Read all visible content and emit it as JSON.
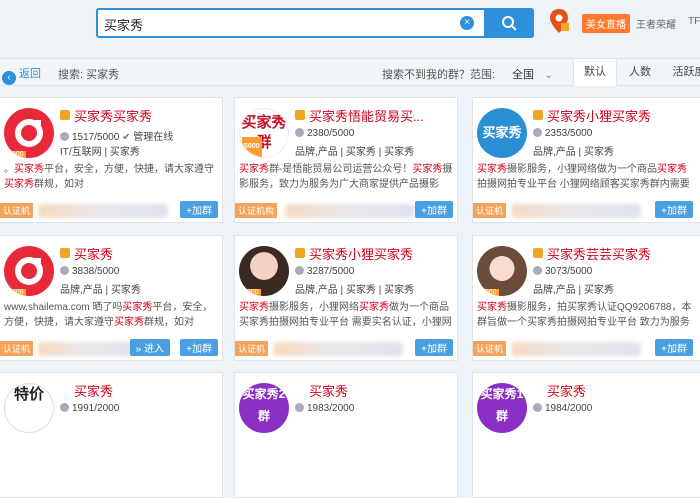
{
  "search": {
    "value": "买家秀"
  },
  "topbar": {
    "live_badge": "美女直播",
    "link1": "王者荣耀",
    "link2": "TF"
  },
  "subbar": {
    "back_label": "返回",
    "crumb": "搜索: 买家秀",
    "not_found": "搜索不到我的群？",
    "range_label": "范围:",
    "range_value": "全国",
    "tabs": [
      "默认",
      "人数",
      "活跃度"
    ]
  },
  "cards": [
    {
      "name": "买家秀买家秀",
      "members": "1517/5000",
      "extra": "管理在线",
      "tags": "IT/互联网 | 买家秀",
      "desc_a": "。",
      "desc_hl": "买家秀",
      "desc_b": "平台，安全，方便，快捷，请大家遵守",
      "desc_c": "群规，如对",
      "cert": "认证机",
      "join": "+加群",
      "level": "5000"
    },
    {
      "name": "买家秀悟能贸易买...",
      "members": "2380/5000",
      "tags": "品牌,产品 | 买家秀 | 买家秀",
      "desc_a": "",
      "desc_hl": "买家秀",
      "desc_b": "群-是悟能贸易公司运营公众号！",
      "desc_c": "摄影服务，致力为服务为广大商家提供产品摄影",
      "cert": "认证机构",
      "join": "+加群",
      "level": "5000",
      "avatar_text": "买家秀群"
    },
    {
      "name": "买家秀小狸买家秀",
      "members": "2353/5000",
      "tags": "品牌,产品 | 买家秀",
      "desc_a": "",
      "desc_hl": "买家秀",
      "desc_b": "摄影服务，小狸网络做为一个商品",
      "desc_c": "拍摄网拍专业平台 小狸网络顾客买家秀群内需要全...",
      "cert": "认证机",
      "join": "+加群",
      "level": "5000",
      "avatar_text": "买家秀"
    },
    {
      "name": "买家秀",
      "members": "3838/5000",
      "tags": "品牌,产品 | 买家秀",
      "desc_a": "www.shailema.com 晒了吗",
      "desc_hl": "买家秀",
      "desc_b": "平台，安全，方便，快捷，请大家遵守",
      "desc_c": "群规，如对",
      "cert": "认证机",
      "enter": "» 进入",
      "join": "+加群",
      "level": "5000"
    },
    {
      "name": "买家秀小狸买家秀",
      "members": "3287/5000",
      "tags": "品牌,产品 | 买家秀 | 买家秀",
      "desc_a": "",
      "desc_hl": "买家秀",
      "desc_b": "摄影服务，小狸网络",
      "desc_c": "做为一个商品买家秀拍摄网拍专业平台 需要实名认证，小狸网络",
      "cert": "认证机",
      "join": "+加群",
      "level": "5000"
    },
    {
      "name": "买家秀芸芸买家秀",
      "members": "3073/5000",
      "tags": "品牌,产品 | 买家秀",
      "desc_a": "",
      "desc_hl": "买家秀",
      "desc_b": "摄影服务，拍买家秀认证QQ9206788，本",
      "desc_c": "群旨做一个买家秀拍摄网拍专业平台 致力为服务",
      "cert": "认证机",
      "join": "+加群",
      "level": "5000"
    },
    {
      "name": "买家秀",
      "members": "1991/2000",
      "tags": "",
      "desc_a": "",
      "desc_hl": "",
      "desc_b": "",
      "desc_c": "",
      "cert": "",
      "join": "",
      "level": "",
      "avatar_text": "特价"
    },
    {
      "name": "买家秀",
      "members": "1983/2000",
      "tags": "",
      "desc_a": "",
      "desc_hl": "",
      "desc_b": "",
      "desc_c": "",
      "cert": "",
      "join": "",
      "level": "",
      "avatar_text": "买家秀2群"
    },
    {
      "name": "买家秀",
      "members": "1984/2000",
      "tags": "",
      "desc_a": "",
      "desc_hl": "",
      "desc_b": "",
      "desc_c": "",
      "cert": "",
      "join": "",
      "level": "",
      "avatar_text": "买家秀1群"
    }
  ],
  "colors": {
    "accent": "#2e8fdb",
    "name_red": "#d0021b",
    "cert_orange": "#f4a45a",
    "join_blue": "#4a9fe0"
  }
}
